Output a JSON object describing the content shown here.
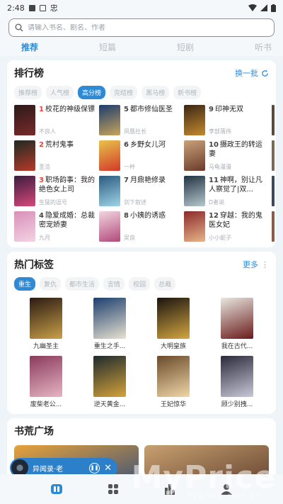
{
  "status": {
    "time": "2:48",
    "app_glyph": "忠"
  },
  "search": {
    "placeholder": "请输入书名、剧名、作者"
  },
  "tabs": [
    {
      "label": "推荐",
      "active": true
    },
    {
      "label": "短篇",
      "active": false
    },
    {
      "label": "短剧",
      "active": false
    },
    {
      "label": "听书",
      "active": false
    }
  ],
  "ranking": {
    "title": "排行榜",
    "action": "换一批",
    "chips": [
      {
        "label": "推荐榜",
        "active": false
      },
      {
        "label": "人气榜",
        "active": false
      },
      {
        "label": "高分榜",
        "active": true
      },
      {
        "label": "完结榜",
        "active": false
      },
      {
        "label": "黑马榜",
        "active": false
      },
      {
        "label": "新书榜",
        "active": false
      }
    ],
    "books": [
      {
        "num": "1",
        "name": "校花的神级保镖",
        "author": "不良人",
        "c1": "#2b1a1a",
        "c2": "#7a2a2a"
      },
      {
        "num": "5",
        "name": "都市修仙医圣",
        "author": "凤凰社长",
        "c1": "#1c3b6e",
        "c2": "#c8a55a"
      },
      {
        "num": "9",
        "name": "印神无双",
        "author": "李部落伟",
        "c1": "#3a2614",
        "c2": "#c48a2e"
      },
      {
        "num": "2",
        "name": "荒村鬼事",
        "author": "圣浩",
        "c1": "#1d2a22",
        "c2": "#b83a2a"
      },
      {
        "num": "6",
        "name": "乡野女儿河",
        "author": "一杯",
        "c1": "#e8c34a",
        "c2": "#d23a2a"
      },
      {
        "num": "10",
        "name": "摄政王的转运妻",
        "author": "马龟漫漫",
        "c1": "#c9a27a",
        "c2": "#6a3b2a"
      },
      {
        "num": "3",
        "name": "职场韵事：我的绝色女上司",
        "author": "生猛的逗号",
        "c1": "#3a1d3e",
        "c2": "#d7487a"
      },
      {
        "num": "7",
        "name": "月鼎艳修录",
        "author": "剑下叙述",
        "c1": "#2a5a7e",
        "c2": "#9fd4e6"
      },
      {
        "num": "11",
        "name": "神啊，别让凡人察觉了|双...",
        "author": "D者说",
        "c1": "#1e3340",
        "c2": "#b7c7cf"
      },
      {
        "num": "4",
        "name": "隐爱成婚：总裁密宠娇妻",
        "author": "九月",
        "c1": "#d98fb8",
        "c2": "#f3d3e4"
      },
      {
        "num": "8",
        "name": "小姨的诱惑",
        "author": "吴良",
        "c1": "#f2d6e0",
        "c2": "#b24a7a"
      },
      {
        "num": "12",
        "name": "穿越：我的鬼医女妃",
        "author": "小小妮子",
        "c1": "#8a2a2a",
        "c2": "#e8b48a"
      }
    ]
  },
  "tags": {
    "title": "热门标签",
    "action": "更多",
    "chips": [
      {
        "label": "重生",
        "active": true
      },
      {
        "label": "复仇",
        "active": false
      },
      {
        "label": "都市生活",
        "active": false
      },
      {
        "label": "言情",
        "active": false
      },
      {
        "label": "校园",
        "active": false
      },
      {
        "label": "总裁",
        "active": false
      }
    ],
    "books": [
      {
        "name": "九幽圣主",
        "c1": "#2a1a12",
        "c2": "#c9a04a"
      },
      {
        "name": "重生之手...",
        "c1": "#1c3e6e",
        "c2": "#e8e2d0"
      },
      {
        "name": "大明皇族",
        "c1": "#1a1410",
        "c2": "#d4a640"
      },
      {
        "name": "我在古代...",
        "c1": "#e8e6e0",
        "c2": "#6a1a1a"
      },
      {
        "name": "废柴老公...",
        "c1": "#8a3b5a",
        "c2": "#e6b4c4"
      },
      {
        "name": "逆天黄金...",
        "c1": "#1e2a2e",
        "c2": "#d4a23a"
      },
      {
        "name": "王妃惊华",
        "c1": "#6a4a2a",
        "c2": "#f0d6a8"
      },
      {
        "name": "顾少别拽...",
        "c1": "#2a2a3a",
        "c2": "#c8c8d8"
      }
    ]
  },
  "square": {
    "title": "书荒广场",
    "left": {
      "c1": "#e8a23a",
      "c2": "#2a4a7e"
    },
    "right": {
      "c1": "#c8a070",
      "c2": "#5a3a2a"
    }
  },
  "player": {
    "title": "异闻录·老"
  },
  "nav": [
    "bookshelf-icon",
    "store-icon",
    "rank-icon",
    "profile-icon"
  ],
  "watermark": {
    "main": "MyPrice",
    "sub": "myprice.com.cn"
  },
  "colors": {
    "accent": "#2f8ad6",
    "rank_red": "#e0473f"
  }
}
